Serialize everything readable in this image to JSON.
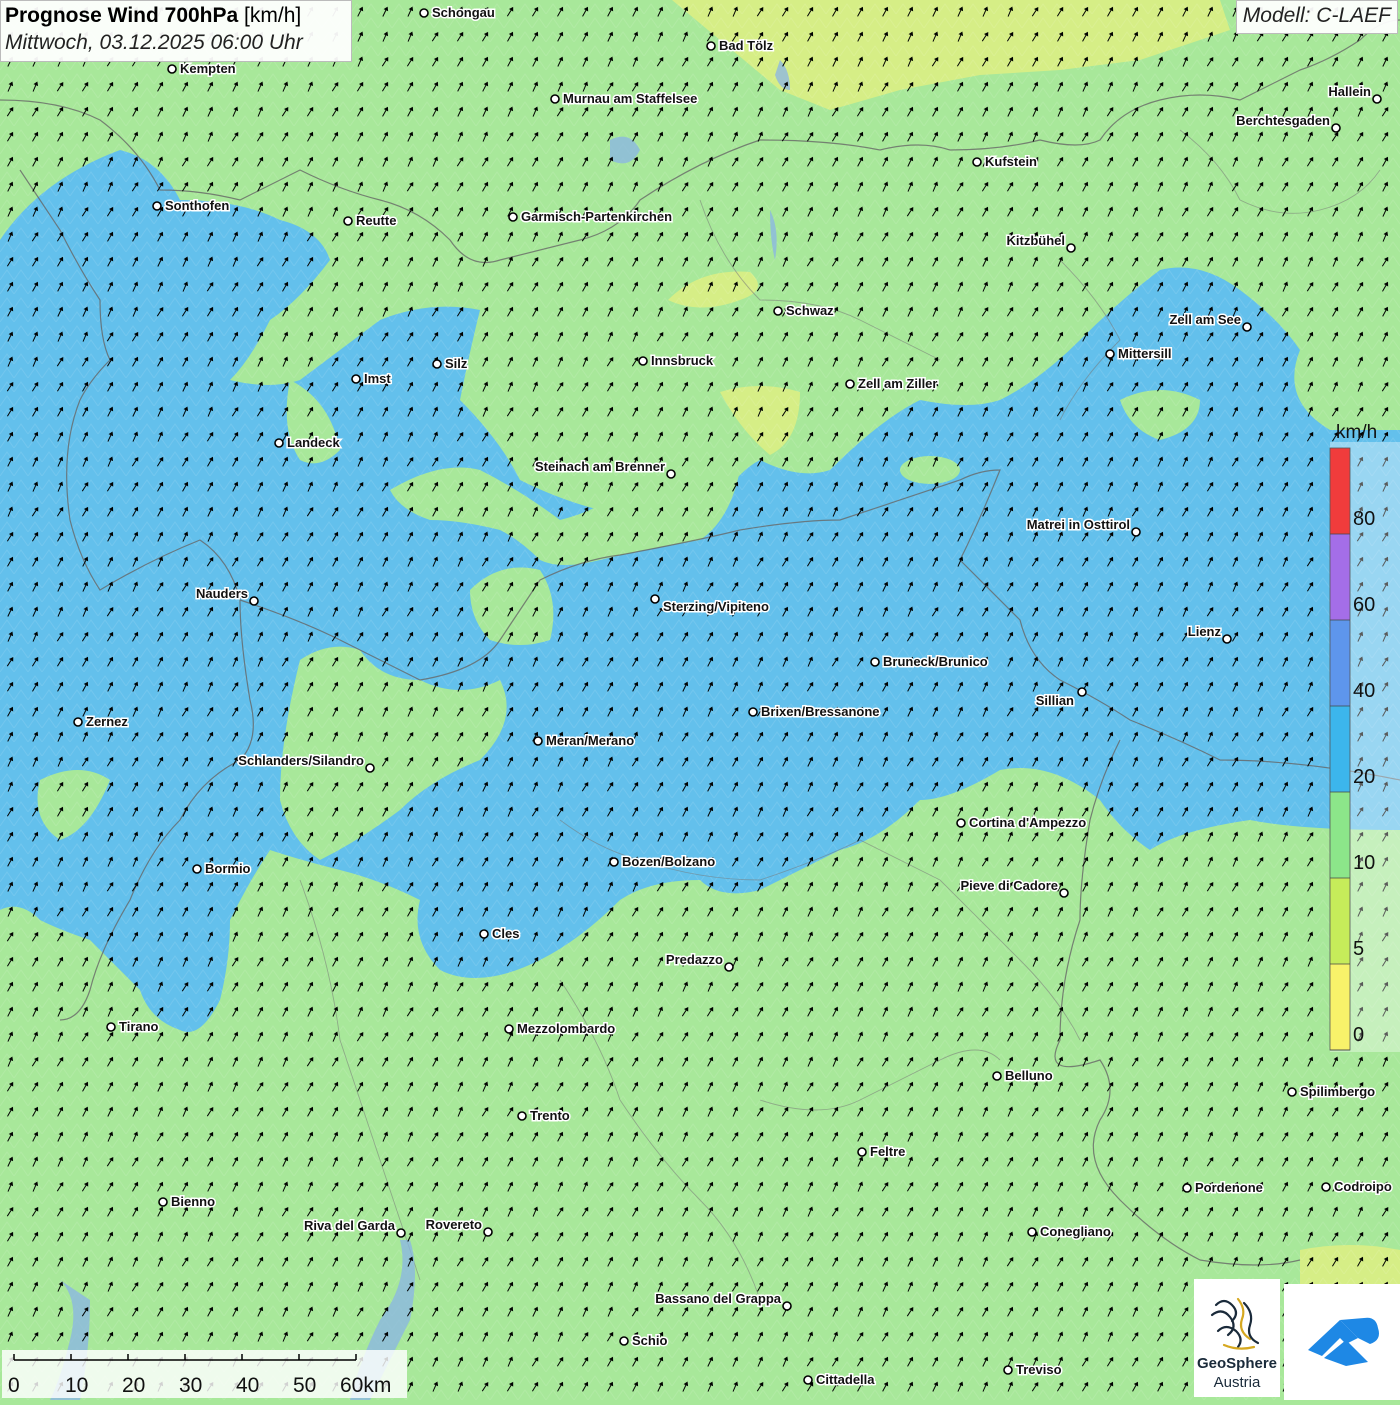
{
  "header": {
    "title_bold": "Prognose Wind 700hPa",
    "title_unit": "[km/h]",
    "subtitle": "Mittwoch, 03.12.2025 06:00 Uhr"
  },
  "model_label": "Modell: C-LAEF",
  "legend": {
    "unit": "km/h",
    "ticks": [
      "80",
      "60",
      "40",
      "20",
      "10",
      "5",
      "0"
    ],
    "colors": [
      "#f03c3c",
      "#a46ee8",
      "#5e96ec",
      "#3cb6ec",
      "#8ce68a",
      "#c6ec5a",
      "#f8f26a"
    ]
  },
  "scale_bar": {
    "labels": [
      "0",
      "10",
      "20",
      "30",
      "40",
      "50",
      "60km"
    ]
  },
  "logos": {
    "geosphere_line1": "GeoSphere",
    "geosphere_line2": "Austria"
  },
  "cities": [
    {
      "name": "Schongau"
    },
    {
      "name": "Bad Tölz"
    },
    {
      "name": "Kempten"
    },
    {
      "name": "Murnau am Staffelsee"
    },
    {
      "name": "Hallein"
    },
    {
      "name": "Berchtesgaden"
    },
    {
      "name": "Kufstein"
    },
    {
      "name": "Sonthofen"
    },
    {
      "name": "Reutte"
    },
    {
      "name": "Garmisch-Partenkirchen"
    },
    {
      "name": "Kitzbühel"
    },
    {
      "name": "Schwaz"
    },
    {
      "name": "Zell am See"
    },
    {
      "name": "Innsbruck"
    },
    {
      "name": "Mittersill"
    },
    {
      "name": "Silz"
    },
    {
      "name": "Imst"
    },
    {
      "name": "Zell am Ziller"
    },
    {
      "name": "Landeck"
    },
    {
      "name": "Steinach am Brenner"
    },
    {
      "name": "Matrei in Osttirol"
    },
    {
      "name": "Nauders"
    },
    {
      "name": "Sterzing/Vipiteno"
    },
    {
      "name": "Lienz"
    },
    {
      "name": "Bruneck/Brunico"
    },
    {
      "name": "Sillian"
    },
    {
      "name": "Zernez"
    },
    {
      "name": "Brixen/Bressanone"
    },
    {
      "name": "Meran/Merano"
    },
    {
      "name": "Schlanders/Silandro"
    },
    {
      "name": "Cortina d'Ampezzo"
    },
    {
      "name": "Bozen/Bolzano"
    },
    {
      "name": "Bormio"
    },
    {
      "name": "Pieve di Cadore"
    },
    {
      "name": "Cles"
    },
    {
      "name": "Predazzo"
    },
    {
      "name": "Tirano"
    },
    {
      "name": "Mezzolombardo"
    },
    {
      "name": "Belluno"
    },
    {
      "name": "Spilimbergo"
    },
    {
      "name": "Trento"
    },
    {
      "name": "Feltre"
    },
    {
      "name": "Pordenone"
    },
    {
      "name": "Codroipo"
    },
    {
      "name": "Bienno"
    },
    {
      "name": "Riva del Garda"
    },
    {
      "name": "Rovereto"
    },
    {
      "name": "Conegliano"
    },
    {
      "name": "Bassano del Grappa"
    },
    {
      "name": "Schio"
    },
    {
      "name": "Treviso"
    },
    {
      "name": "Cittadella"
    }
  ]
}
